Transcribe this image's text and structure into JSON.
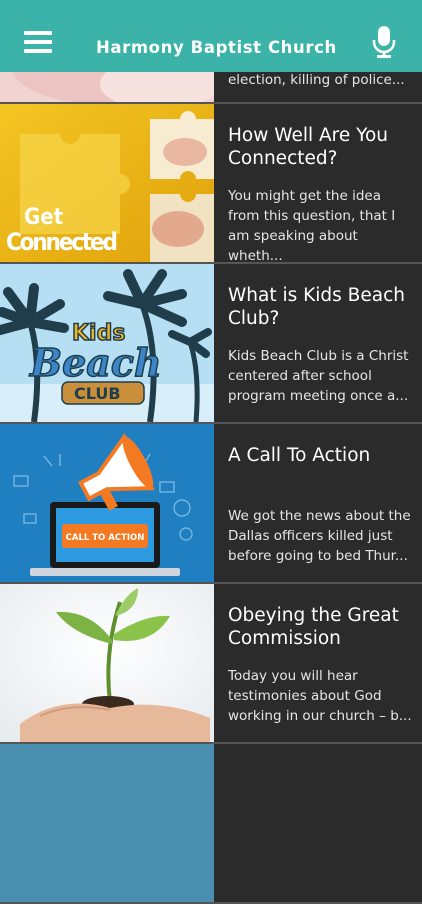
{
  "header": {
    "title": "Harmony Baptist Church",
    "menu_icon": "hamburger-menu-icon",
    "mic_icon": "microphone-icon",
    "background": "#3bb3a8"
  },
  "posts": [
    {
      "title": "",
      "excerpt": "election, killing of police..."
    },
    {
      "title": "How Well Are You\nConnected?",
      "excerpt": "You might get the idea\nfrom this question, that I\nam speaking about wheth...",
      "thumb_text": [
        "Get",
        "Connected"
      ]
    },
    {
      "title": "What is Kids Beach\nClub?",
      "excerpt": "Kids Beach Club is a Christ\ncentered after school\nprogram meeting once a...",
      "thumb_text": [
        "Kids",
        "Beach",
        "CLUB"
      ]
    },
    {
      "title": "A Call To Action",
      "excerpt": "We got the news about the\nDallas officers killed just\nbefore going to bed Thur...",
      "thumb_text": [
        "CALL TO ACTION"
      ]
    },
    {
      "title": "Obeying the Great\nCommission",
      "excerpt": "Today you will hear\ntestimonies about God\nworking in our church – b..."
    }
  ]
}
